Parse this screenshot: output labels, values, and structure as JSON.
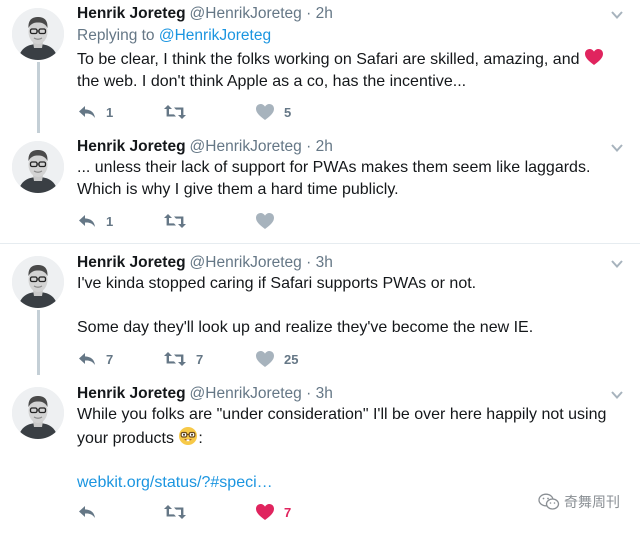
{
  "colors": {
    "text": "#14171a",
    "muted": "#657786",
    "link": "#1b95e0",
    "like": "#e0245e",
    "thread": "#c4cfd6"
  },
  "tweets": [
    {
      "name": "Henrik Joreteg",
      "handle": "@HenrikJoreteg",
      "sep": "·",
      "time": "2h",
      "replying_prefix": "Replying to ",
      "replying_handle": "@HenrikJoreteg",
      "text_before_heart": "To be clear, I think the folks working on Safari are skilled, amazing, and ",
      "heart_emoji": "heart",
      "text_after_heart": " the web. I don't think Apple as a co, has the incentive...",
      "reply_count": "1",
      "retweet_count": "",
      "like_count": "5",
      "liked": false
    },
    {
      "name": "Henrik Joreteg",
      "handle": "@HenrikJoreteg",
      "sep": "·",
      "time": "2h",
      "line1": "... unless their lack of support for PWAs makes them seem like laggards.",
      "line2": "Which is why I give them a hard time publicly.",
      "reply_count": "1",
      "retweet_count": "",
      "like_count": "",
      "liked": false
    },
    {
      "name": "Henrik Joreteg",
      "handle": "@HenrikJoreteg",
      "sep": "·",
      "time": "3h",
      "line1": "I've kinda stopped caring if Safari supports PWAs or not.",
      "line2": "Some day they'll look up and realize they've become the new IE.",
      "reply_count": "7",
      "retweet_count": "7",
      "like_count": "25",
      "liked": false
    },
    {
      "name": "Henrik Joreteg",
      "handle": "@HenrikJoreteg",
      "sep": "·",
      "time": "3h",
      "line1": "While you folks are \"under consideration\" I'll be over here happily not using",
      "line2_before_emoji": "your products ",
      "emoji": "nerd-face",
      "line2_after_emoji": ":",
      "link": "webkit.org/status/?#speci…",
      "reply_count": "",
      "retweet_count": "",
      "like_count": "7",
      "liked": true
    }
  ],
  "watermark": {
    "text": "奇舞周刊",
    "icon": "wechat-icon"
  }
}
